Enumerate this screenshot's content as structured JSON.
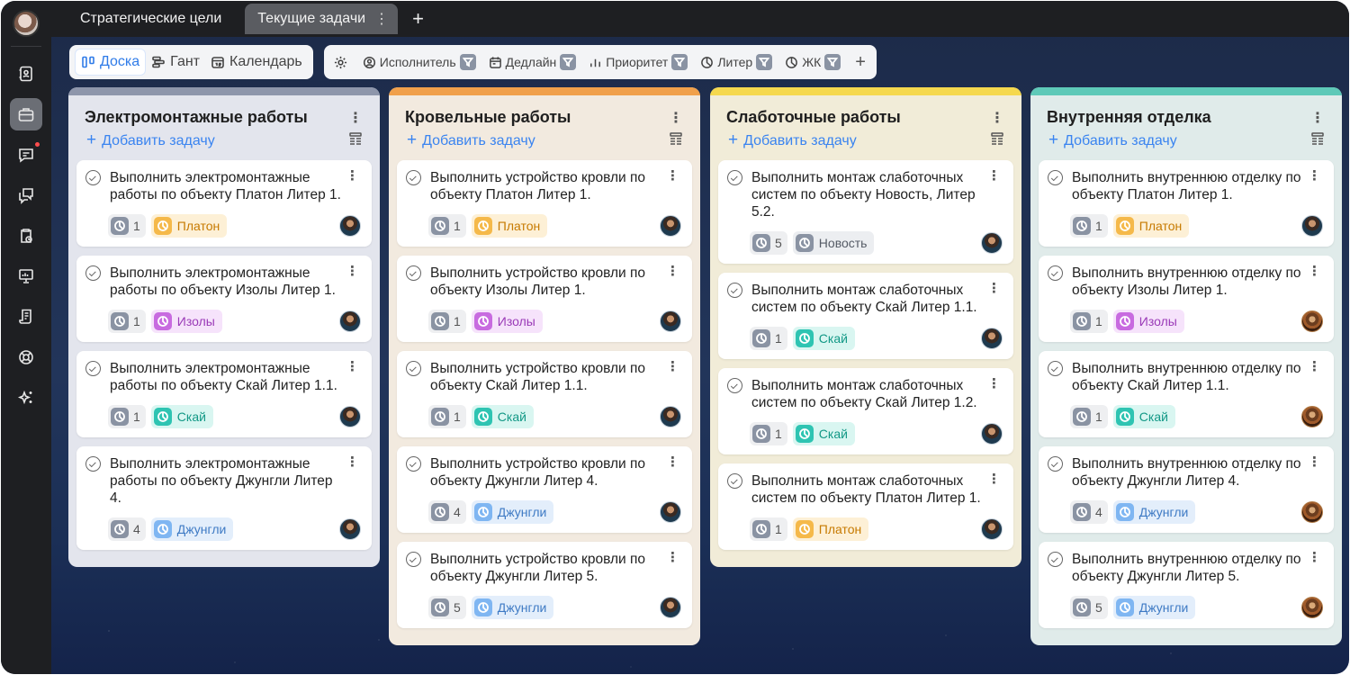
{
  "tabs": [
    {
      "label": "Стратегические цели",
      "active": false
    },
    {
      "label": "Текущие задачи",
      "active": true
    }
  ],
  "views": [
    {
      "label": "Доска",
      "icon": "board-icon",
      "active": true
    },
    {
      "label": "Гант",
      "icon": "gantt-icon",
      "active": false
    },
    {
      "label": "Календарь",
      "icon": "calendar-icon",
      "active": false
    }
  ],
  "filters": [
    {
      "label": "Исполнитель",
      "icon": "user-circle-icon"
    },
    {
      "label": "Дедлайн",
      "icon": "calendar-icon"
    },
    {
      "label": "Приоритет",
      "icon": "bar-chart-icon"
    },
    {
      "label": "Литер",
      "icon": "pie-icon"
    },
    {
      "label": "ЖК",
      "icon": "pie-icon"
    }
  ],
  "colors": {
    "accent": "#2f7be8",
    "Платон": {
      "icon": "#f5b94a",
      "bg": "#fdf0d6",
      "text": "#c77a00"
    },
    "Изолы": {
      "icon": "#c86be0",
      "bg": "#f6e3fb",
      "text": "#9b3bb8"
    },
    "Скай": {
      "icon": "#2ec4b2",
      "bg": "#d9f6f1",
      "text": "#129886"
    },
    "Джунгли": {
      "icon": "#7fb6f2",
      "bg": "#e3eefb",
      "text": "#3e7ac4"
    },
    "Новость": {
      "icon": "#8a93a3",
      "bg": "#eceef1",
      "text": "#555b66"
    }
  },
  "add_task_label": "Добавить задачу",
  "columns": [
    {
      "title": "Электромонтажные работы",
      "bar": "#8e96ab",
      "bg": "#e3e5ed",
      "cards": [
        {
          "title": "Выполнить электромонтажные работы по объекту Платон Литер 1.",
          "count": "1",
          "tag": "Платон",
          "avatar": "main"
        },
        {
          "title": "Выполнить электромонтажные работы по объекту Изолы Литер 1.",
          "count": "1",
          "tag": "Изолы",
          "avatar": "main"
        },
        {
          "title": "Выполнить электромонтажные работы по объекту Скай Литер 1.1.",
          "count": "1",
          "tag": "Скай",
          "avatar": "main"
        },
        {
          "title": "Выполнить электромонтажные работы по объекту Джунгли Литер 4.",
          "count": "4",
          "tag": "Джунгли",
          "avatar": "main"
        }
      ]
    },
    {
      "title": "Кровельные работы",
      "bar": "#f0a04b",
      "bg": "#f2eadf",
      "cards": [
        {
          "title": "Выполнить устройство кровли по объекту Платон Литер 1.",
          "count": "1",
          "tag": "Платон",
          "avatar": "main"
        },
        {
          "title": "Выполнить устройство кровли по объекту Изолы Литер 1.",
          "count": "1",
          "tag": "Изолы",
          "avatar": "main"
        },
        {
          "title": "Выполнить устройство кровли по объекту Скай Литер 1.1.",
          "count": "1",
          "tag": "Скай",
          "avatar": "main"
        },
        {
          "title": "Выполнить устройство кровли по объекту Джунгли Литер 4.",
          "count": "4",
          "tag": "Джунгли",
          "avatar": "main"
        },
        {
          "title": "Выполнить устройство кровли по объекту Джунгли Литер 5.",
          "count": "5",
          "tag": "Джунгли",
          "avatar": "main"
        }
      ]
    },
    {
      "title": "Слаботочные работы",
      "bar": "#f5d84e",
      "bg": "#f1ecd8",
      "cards": [
        {
          "title": "Выполнить монтаж слаботочных систем по объекту Новость, Литер 5.2.",
          "count": "5",
          "tag": "Новость",
          "avatar": "main"
        },
        {
          "title": "Выполнить монтаж слаботочных систем по объекту Скай Литер 1.1.",
          "count": "1",
          "tag": "Скай",
          "avatar": "main"
        },
        {
          "title": "Выполнить монтаж слаботочных систем по объекту Скай Литер 1.2.",
          "count": "1",
          "tag": "Скай",
          "avatar": "main"
        },
        {
          "title": "Выполнить монтаж слаботочных систем по объекту Платон Литер 1.",
          "count": "1",
          "tag": "Платон",
          "avatar": "main"
        }
      ]
    },
    {
      "title": "Внутренняя отделка",
      "bar": "#5ec9b8",
      "bg": "#e0ebea",
      "cards": [
        {
          "title": "Выполнить внутреннюю отделку по объекту Платон Литер 1.",
          "count": "1",
          "tag": "Платон",
          "avatar": "main"
        },
        {
          "title": "Выполнить внутреннюю отделку по объекту Изолы Литер 1.",
          "count": "1",
          "tag": "Изолы",
          "avatar": "alt"
        },
        {
          "title": "Выполнить внутреннюю отделку по объекту Скай Литер 1.1.",
          "count": "1",
          "tag": "Скай",
          "avatar": "alt"
        },
        {
          "title": "Выполнить внутреннюю отделку по объекту Джунгли Литер 4.",
          "count": "4",
          "tag": "Джунгли",
          "avatar": "alt"
        },
        {
          "title": "Выполнить внутреннюю отделку по объекту Джунгли Литер 5.",
          "count": "5",
          "tag": "Джунгли",
          "avatar": "alt"
        }
      ]
    }
  ]
}
